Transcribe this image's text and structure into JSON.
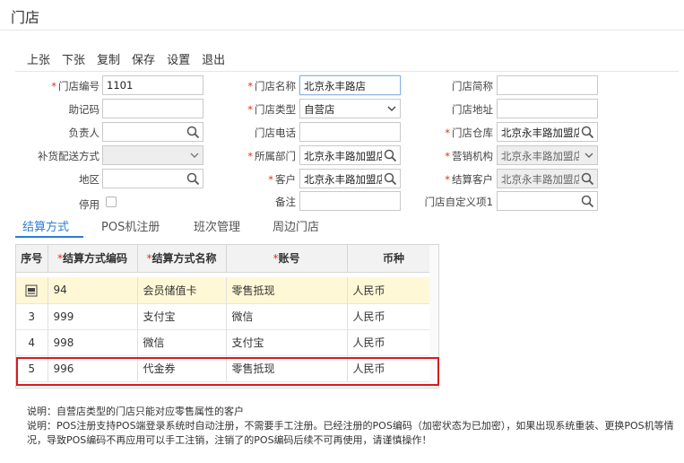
{
  "window": {
    "title": "门店"
  },
  "toolbar": {
    "buttons": [
      "上张",
      "下张",
      "复制",
      "保存",
      "设置",
      "退出"
    ]
  },
  "form": {
    "store_code": {
      "label": "门店编号",
      "value": "1101"
    },
    "store_name": {
      "label": "门店名称",
      "value": "北京永丰路店"
    },
    "short_name": {
      "label": "门店简称",
      "value": ""
    },
    "mnemonic": {
      "label": "助记码",
      "value": ""
    },
    "store_type": {
      "label": "门店类型",
      "value": "自营店"
    },
    "store_address": {
      "label": "门店地址",
      "value": ""
    },
    "manager": {
      "label": "负责人",
      "value": ""
    },
    "store_phone": {
      "label": "门店电话",
      "value": ""
    },
    "store_warehouse": {
      "label": "门店仓库",
      "value": "北京永丰路加盟店"
    },
    "replenish_mode": {
      "label": "补货配送方式",
      "value": ""
    },
    "department": {
      "label": "所属部门",
      "value": "北京永丰路加盟店"
    },
    "sales_org": {
      "label": "营销机构",
      "value": "北京永丰路加盟店"
    },
    "region": {
      "label": "地区",
      "value": ""
    },
    "customer": {
      "label": "客户",
      "value": "北京永丰路加盟店"
    },
    "settle_customer": {
      "label": "结算客户",
      "value": "北京永丰路加盟店"
    },
    "disabled": {
      "label": "停用",
      "checked": false
    },
    "remark": {
      "label": "备注",
      "value": ""
    },
    "custom1": {
      "label": "门店自定义项1",
      "value": ""
    }
  },
  "tabs": [
    "结算方式",
    "POS机注册",
    "班次管理",
    "周边门店"
  ],
  "active_tab": "结算方式",
  "grid": {
    "headers": {
      "seq": "序号",
      "code": "结算方式编码",
      "name": "结算方式名称",
      "account": "账号",
      "currency": "币种"
    },
    "rows": [
      {
        "seq": "",
        "code": "94",
        "name": "会员储值卡",
        "account": "零售抵现",
        "currency": "人民币",
        "selected": true
      },
      {
        "seq": "3",
        "code": "999",
        "name": "支付宝",
        "account": "微信",
        "currency": "人民币"
      },
      {
        "seq": "4",
        "code": "998",
        "name": "微信",
        "account": "支付宝",
        "currency": "人民币"
      },
      {
        "seq": "5",
        "code": "996",
        "name": "代金券",
        "account": "零售抵现",
        "currency": "人民币",
        "highlighted": true
      }
    ]
  },
  "notes": [
    "说明：自营店类型的门店只能对应零售属性的客户",
    "说明：POS注册支持POS端登录系统时自动注册，不需要手工注册。已经注册的POS编码（加密状态为已加密），如果出现系统重装、更换POS机等情况，导致POS编码不再应用可以手工注销，注销了的POS编码后续不可再使用，请谨慎操作！"
  ],
  "colors": {
    "accent": "#2b7cd3",
    "required": "#e0301e",
    "selected_row": "#fff8d6",
    "highlight_border": "#d9191d"
  }
}
